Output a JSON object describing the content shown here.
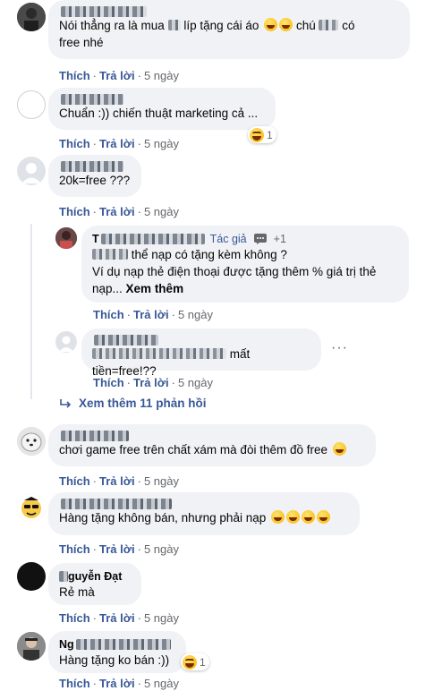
{
  "actions": {
    "like": "Thích",
    "reply": "Trả lời"
  },
  "comments": [
    {
      "name_visible": "",
      "text": "Nói thẳng ra là mua ",
      "text2": "líp tặng cái áo",
      "text3": "chú",
      "text4": "có",
      "text5": "free nhé",
      "time": "5 ngày"
    },
    {
      "name_visible": "",
      "text": "Chuẩn :)) chiến thuật marketing cả ...",
      "time": "5 ngày",
      "reaction_count": "1"
    },
    {
      "name_visible": "",
      "text": "20k=free ???",
      "time": "5 ngày"
    },
    {
      "name_visible": "T",
      "badge": "Tác giả",
      "plus": "+1",
      "text": "thể nạp có tặng kèm không ?",
      "text2": "Ví dụ nạp thẻ điện thoại được tặng thêm % giá trị thẻ nạp...",
      "see_more": "Xem thêm",
      "time": "5 ngày"
    },
    {
      "name_visible": "",
      "text": "mất tiền=free!??",
      "time": "5 ngày"
    },
    {
      "name_visible": "",
      "text": "chơi game free trên chất xám mà đòi thêm đồ free",
      "time": "5 ngày"
    },
    {
      "name_visible": "",
      "text": "Hàng tặng không bán, nhưng phải nạp",
      "time": "5 ngày"
    },
    {
      "name_visible": "guyễn Đạt",
      "text": "Rẻ mà",
      "time": "5 ngày"
    },
    {
      "name_visible": "Ng",
      "text": "Hàng tặng ko bán :))",
      "time": "5 ngày",
      "reaction_count": "1"
    }
  ],
  "view_more_replies": "Xem thêm 11 phản hồi",
  "more_options": "···",
  "colors": {
    "link": "#385898",
    "bubble": "#f0f2f5",
    "meta": "#65676b"
  }
}
